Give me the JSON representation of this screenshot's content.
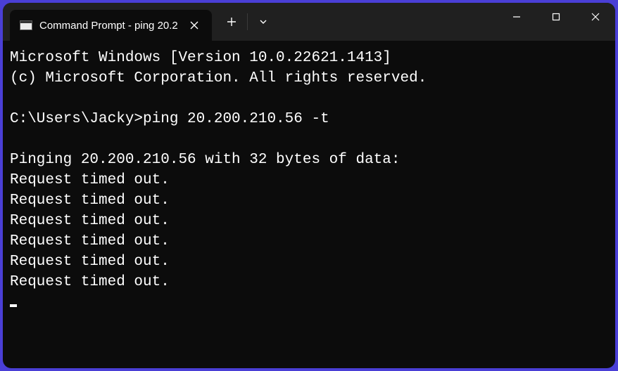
{
  "tab": {
    "title": "Command Prompt - ping  20.2"
  },
  "terminal": {
    "line1": "Microsoft Windows [Version 10.0.22621.1413]",
    "line2": "(c) Microsoft Corporation. All rights reserved.",
    "blank1": "",
    "prompt": "C:\\Users\\Jacky>ping 20.200.210.56 -t",
    "blank2": "",
    "ping_header": "Pinging 20.200.210.56 with 32 bytes of data:",
    "r1": "Request timed out.",
    "r2": "Request timed out.",
    "r3": "Request timed out.",
    "r4": "Request timed out.",
    "r5": "Request timed out.",
    "r6": "Request timed out."
  }
}
